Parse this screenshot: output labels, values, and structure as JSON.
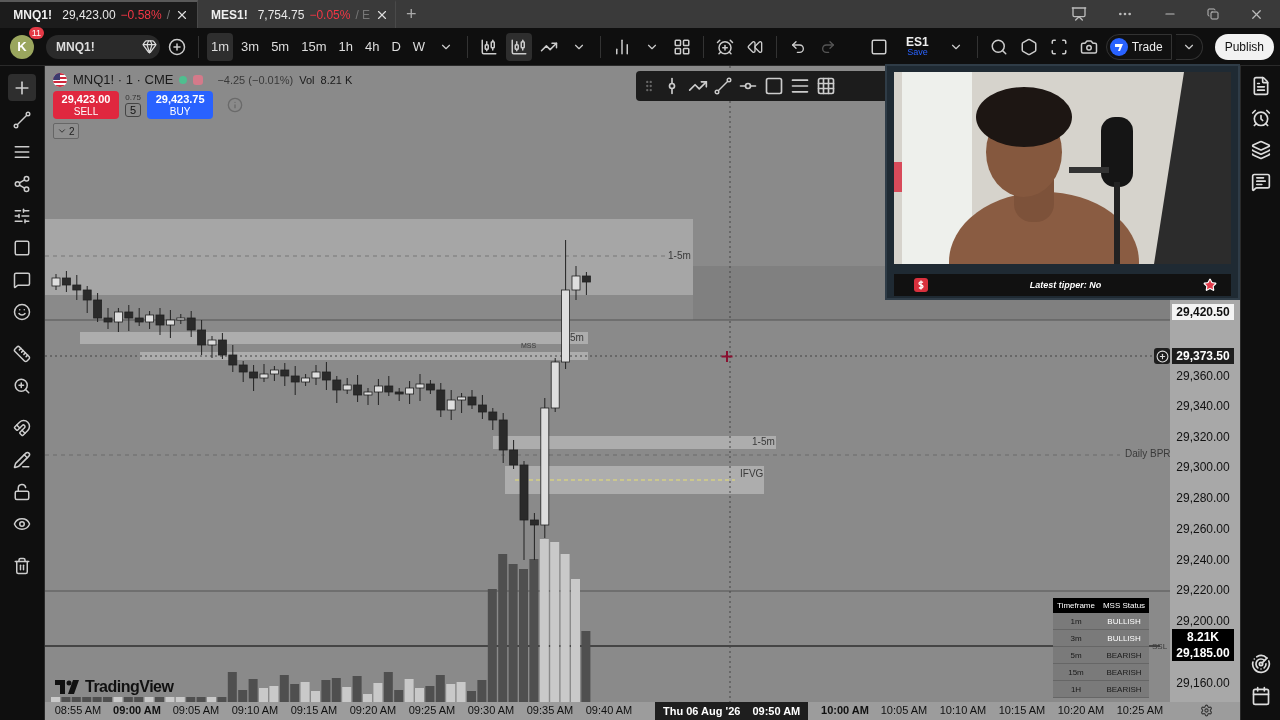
{
  "tabs": [
    {
      "symbol": "MNQ1!",
      "price": "29,423.00",
      "change": "−0.58%",
      "rest": "/",
      "selected": true
    },
    {
      "symbol": "MES1!",
      "price": "7,754.75",
      "change": "−0.05%",
      "rest": "/ E",
      "selected": false
    }
  ],
  "new_tab": "+",
  "toolbar": {
    "avatar": "K",
    "notifications": "11",
    "symbol": "MNQ1!",
    "intervals": [
      {
        "label": "1m",
        "selected": true
      },
      {
        "label": "3m",
        "selected": false
      },
      {
        "label": "5m",
        "selected": false
      },
      {
        "label": "15m",
        "selected": false
      },
      {
        "label": "1h",
        "selected": false
      },
      {
        "label": "4h",
        "selected": false
      },
      {
        "label": "D",
        "selected": false
      },
      {
        "label": "W",
        "selected": false
      }
    ],
    "layout_name": "ES1",
    "layout_status": "Save",
    "trade": "Trade",
    "publish": "Publish"
  },
  "legend": {
    "title": "MNQ1! · 1 · CME",
    "change": "−4.25 (−0.01%)",
    "volume_label": "Vol",
    "volume": "8.21 K",
    "sell_price": "29,423.00",
    "sell": "SELL",
    "spread": "0.75",
    "quantity": "5",
    "buy_price": "29,423.75",
    "buy": "BUY",
    "collapsed_count": "2"
  },
  "annotations": [
    {
      "text": "1-5m"
    },
    {
      "text": "5m"
    },
    {
      "text": "MSS"
    },
    {
      "text": "1-5m"
    },
    {
      "text": "IFVG"
    },
    {
      "text": "Daily BPR"
    },
    {
      "text": "SSL"
    }
  ],
  "price_axis": [
    {
      "text": "29,420.50",
      "kind": "last"
    },
    {
      "text": "29,373.50",
      "kind": "crosshair"
    },
    {
      "text": "29,360.00",
      "kind": "tick"
    },
    {
      "text": "29,340.00",
      "kind": "tick"
    },
    {
      "text": "29,320.00",
      "kind": "tick"
    },
    {
      "text": "29,300.00",
      "kind": "tick"
    },
    {
      "text": "29,280.00",
      "kind": "tick"
    },
    {
      "text": "29,260.00",
      "kind": "tick"
    },
    {
      "text": "29,240.00",
      "kind": "tick"
    },
    {
      "text": "29,220.00",
      "kind": "tick"
    },
    {
      "text": "29,200.00",
      "kind": "tick"
    },
    {
      "text": "8.21K",
      "kind": "marker"
    },
    {
      "text": "29,185.00",
      "kind": "marker"
    },
    {
      "text": "29,160.00",
      "kind": "tick"
    }
  ],
  "time_axis": [
    {
      "kind": "tick",
      "text": "08:55 AM",
      "major": false
    },
    {
      "kind": "tick",
      "text": "09:00 AM",
      "major": true
    },
    {
      "kind": "tick",
      "text": "09:05 AM",
      "major": false
    },
    {
      "kind": "tick",
      "text": "09:10 AM",
      "major": false
    },
    {
      "kind": "tick",
      "text": "09:15 AM",
      "major": false
    },
    {
      "kind": "tick",
      "text": "09:20 AM",
      "major": false
    },
    {
      "kind": "tick",
      "text": "09:25 AM",
      "major": false
    },
    {
      "kind": "tick",
      "text": "09:30 AM",
      "major": false
    },
    {
      "kind": "tick",
      "text": "09:35 AM",
      "major": false
    },
    {
      "kind": "tick",
      "text": "09:40 AM",
      "major": false
    },
    {
      "kind": "crosshair",
      "date": "Thu 06 Aug '26",
      "time": "09:50 AM"
    },
    {
      "kind": "tick",
      "text": "10:00 AM",
      "major": true
    },
    {
      "kind": "tick",
      "text": "10:05 AM",
      "major": false
    },
    {
      "kind": "tick",
      "text": "10:10 AM",
      "major": false
    },
    {
      "kind": "tick",
      "text": "10:15 AM",
      "major": false
    },
    {
      "kind": "tick",
      "text": "10:20 AM",
      "major": false
    },
    {
      "kind": "tick",
      "text": "10:25 AM",
      "major": false
    }
  ],
  "mss_table": {
    "columns": [
      "Timeframe",
      "MSS Status"
    ],
    "rows": [
      {
        "timeframe": "1m",
        "status": "BULLISH",
        "bullish": true
      },
      {
        "timeframe": "3m",
        "status": "BULLISH",
        "bullish": true
      },
      {
        "timeframe": "5m",
        "status": "BEARISH",
        "bullish": false
      },
      {
        "timeframe": "15m",
        "status": "BEARISH",
        "bullish": false
      },
      {
        "timeframe": "1H",
        "status": "BEARISH",
        "bullish": false
      }
    ]
  },
  "stream_overlay": {
    "ticker_text": "Latest tipper: No"
  },
  "branding": "TradingView"
}
